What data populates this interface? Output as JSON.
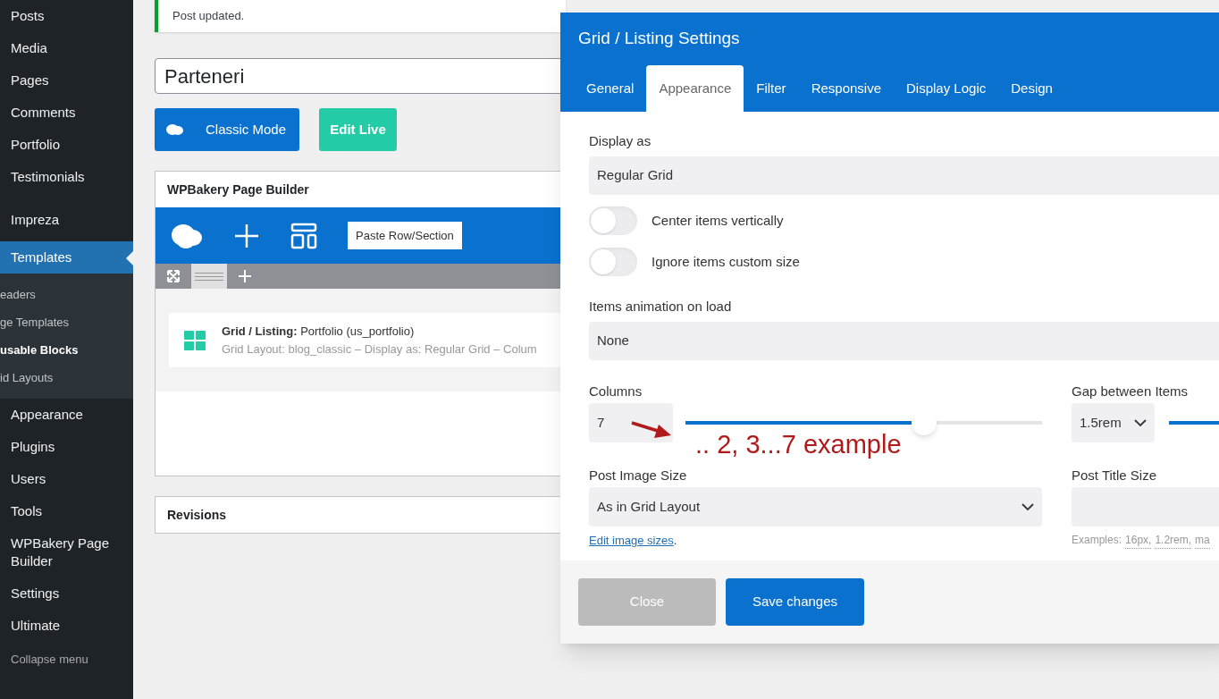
{
  "sidebar": {
    "items": [
      {
        "label": "Posts",
        "selected": false
      },
      {
        "label": "Media",
        "selected": false
      },
      {
        "label": "Pages",
        "selected": false
      },
      {
        "label": "Comments",
        "selected": false
      },
      {
        "label": "Portfolio",
        "selected": false
      },
      {
        "label": "Testimonials",
        "selected": false
      },
      {
        "label": "Impreza",
        "selected": false
      },
      {
        "label": "Templates",
        "selected": true,
        "children": [
          {
            "label": "eaders",
            "selected": false
          },
          {
            "label": "ge Templates",
            "selected": false
          },
          {
            "label": "usable Blocks",
            "selected": true
          },
          {
            "label": "id Layouts",
            "selected": false
          }
        ]
      },
      {
        "label": "Appearance",
        "selected": false
      },
      {
        "label": "Plugins",
        "selected": false
      },
      {
        "label": "Users",
        "selected": false
      },
      {
        "label": "Tools",
        "selected": false
      },
      {
        "label": "WPBakery Page Builder",
        "selected": false
      },
      {
        "label": "Settings",
        "selected": false
      },
      {
        "label": "Ultimate",
        "selected": false
      }
    ],
    "collapse": "Collapse menu"
  },
  "notice": "Post updated.",
  "post_title": "Parteneri",
  "mode_buttons": {
    "classic": "Classic Mode",
    "live": "Edit Live"
  },
  "builder": {
    "title": "WPBakery Page Builder",
    "paste": "Paste Row/Section",
    "element": {
      "name": "Grid / Listing:",
      "value": "Portfolio (us_portfolio)",
      "summary": "Grid Layout: blog_classic – Display as: Regular Grid – Colum"
    }
  },
  "revisions": "Revisions",
  "dialog": {
    "title": "Grid / Listing Settings",
    "tabs": [
      {
        "label": "General",
        "selected": false
      },
      {
        "label": "Appearance",
        "selected": true
      },
      {
        "label": "Filter",
        "selected": false
      },
      {
        "label": "Responsive",
        "selected": false
      },
      {
        "label": "Display Logic",
        "selected": false
      },
      {
        "label": "Design",
        "selected": false
      }
    ],
    "display_as": {
      "label": "Display as",
      "value": "Regular Grid"
    },
    "toggles": [
      {
        "label": "Center items vertically",
        "on": false
      },
      {
        "label": "Ignore items custom size",
        "on": false
      }
    ],
    "animation": {
      "label": "Items animation on load",
      "value": "None"
    },
    "columns": {
      "label": "Columns",
      "value": "7",
      "level": 0.67
    },
    "gap": {
      "label": "Gap between Items",
      "value": "1.5rem",
      "level": 1
    },
    "image_size": {
      "label": "Post Image Size",
      "value": "As in Grid Layout",
      "link": "Edit image sizes",
      "link_after": "."
    },
    "title_size": {
      "label": "Post Title Size",
      "examples_prefix": "Examples:",
      "examples": [
        "16px,",
        "1.2rem,",
        "ma"
      ]
    },
    "buttons": {
      "close": "Close",
      "save": "Save changes"
    }
  },
  "annotation": ".. 2, 3...7 example"
}
